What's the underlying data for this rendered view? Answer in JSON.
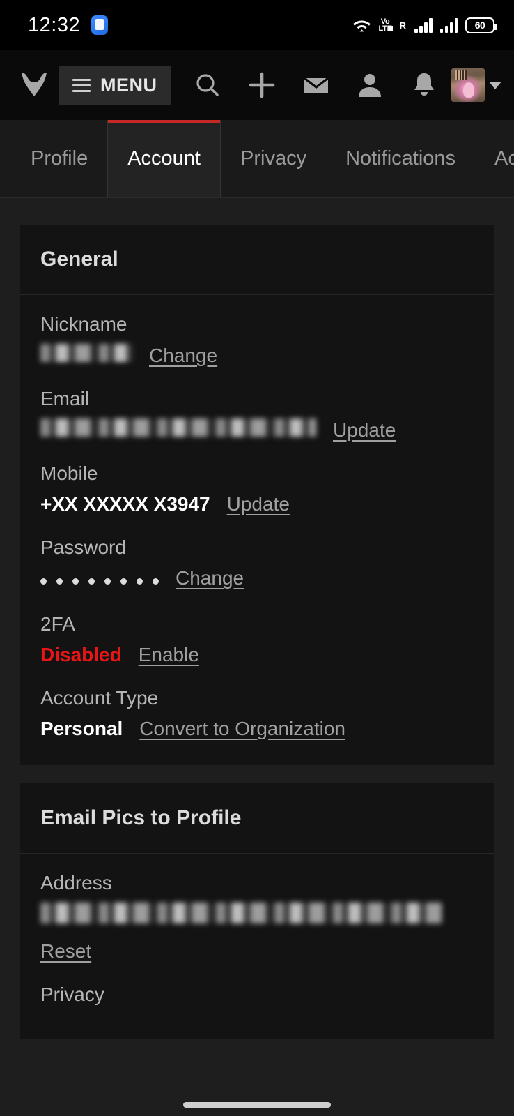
{
  "theme": {
    "accent_red": "#c62828",
    "danger_red": "#e71515",
    "page_bg": "#1e1e1e",
    "card_bg": "#131313",
    "navbar_bg": "#0a0a0a"
  },
  "status_bar": {
    "clock": "12:32",
    "app_icon": "message-app-icon",
    "wifi_icon": "wifi-icon",
    "volte_line1": "Vo",
    "volte_line2": "LTE",
    "roaming_label": "R",
    "signal_icon_1": "signal-bars-icon",
    "signal_icon_2": "signal-bars-icon",
    "battery_level": "60"
  },
  "navbar": {
    "logo_icon": "site-logo-icon",
    "menu_label": "MENU",
    "menu_icon": "hamburger-icon",
    "icons": [
      {
        "name": "search-icon"
      },
      {
        "name": "add-plus-icon"
      },
      {
        "name": "mail-envelope-icon"
      },
      {
        "name": "user-person-icon"
      },
      {
        "name": "notifications-bell-icon"
      }
    ],
    "avatar_alt": "user-avatar",
    "caret_icon": "chevron-down-icon"
  },
  "tabs": [
    {
      "label": "Profile",
      "active": false
    },
    {
      "label": "Account",
      "active": true
    },
    {
      "label": "Privacy",
      "active": false
    },
    {
      "label": "Notifications",
      "active": false
    },
    {
      "label": "Activi",
      "active": false
    }
  ],
  "general_card": {
    "title": "General",
    "fields": {
      "nickname": {
        "label": "Nickname",
        "value": "",
        "value_redacted": true,
        "action": "Change"
      },
      "email": {
        "label": "Email",
        "value": "",
        "value_redacted": true,
        "action": "Update"
      },
      "mobile": {
        "label": "Mobile",
        "value": "+XX XXXXX X3947",
        "action": "Update"
      },
      "password": {
        "label": "Password",
        "value": "••••••••",
        "dot_count": 8,
        "action": "Change"
      },
      "twofa": {
        "label": "2FA",
        "value": "Disabled",
        "action": "Enable"
      },
      "account_type": {
        "label": "Account Type",
        "value": "Personal",
        "action": "Convert to Organization"
      }
    }
  },
  "email_pics_card": {
    "title": "Email Pics to Profile",
    "fields": {
      "address": {
        "label": "Address",
        "value": "",
        "value_redacted": true,
        "action": "Reset"
      },
      "privacy": {
        "label": "Privacy"
      }
    }
  }
}
